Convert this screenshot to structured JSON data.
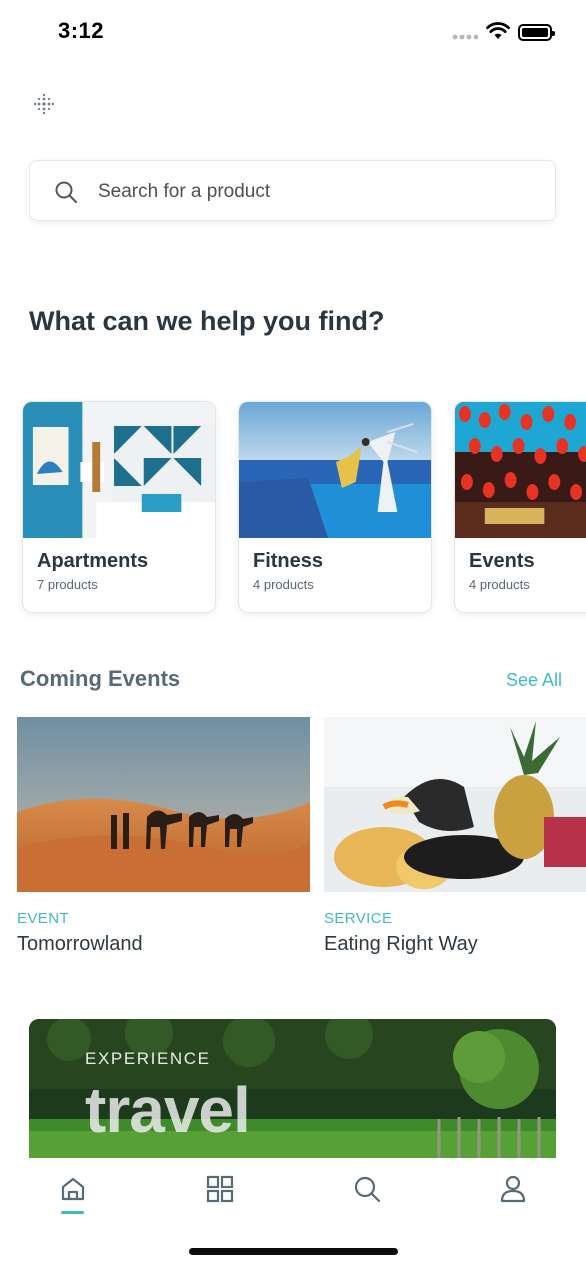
{
  "status_bar": {
    "time": "3:12"
  },
  "search": {
    "placeholder": "Search for a product"
  },
  "help": {
    "title": "What can we help you find?"
  },
  "categories": [
    {
      "name": "Apartments",
      "count": "7 products"
    },
    {
      "name": "Fitness",
      "count": "4 products"
    },
    {
      "name": "Events",
      "count": "4 products"
    }
  ],
  "coming_events": {
    "title": "Coming Events",
    "see_all": "See All",
    "items": [
      {
        "type": "EVENT",
        "name": "Tomorrowland"
      },
      {
        "type": "SERVICE",
        "name": "Eating Right Way"
      }
    ]
  },
  "banner": {
    "subtitle": "EXPERIENCE",
    "title": "travel"
  },
  "tabbar": {
    "items": [
      {
        "icon": "home-icon",
        "active": true
      },
      {
        "icon": "grid-icon",
        "active": false
      },
      {
        "icon": "search-icon",
        "active": false
      },
      {
        "icon": "user-icon",
        "active": false
      }
    ]
  },
  "colors": {
    "accent": "#3fbcc3",
    "heading": "#2a3640",
    "section": "#566b75"
  }
}
